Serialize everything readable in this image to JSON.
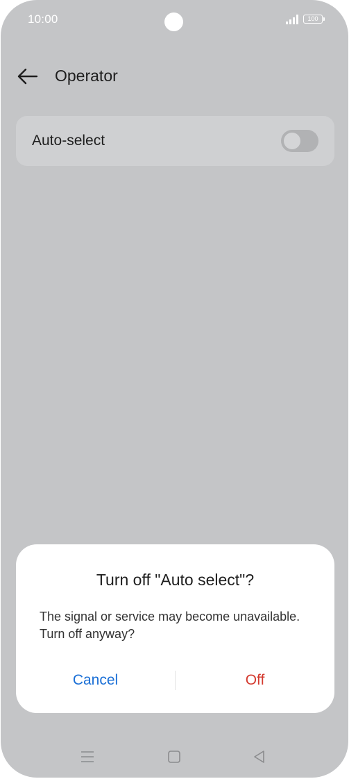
{
  "status_bar": {
    "time": "10:00",
    "battery": "100",
    "icons": [
      "signal-icon",
      "battery-icon"
    ]
  },
  "header": {
    "title": "Operator",
    "back_icon": "arrow-left-icon"
  },
  "setting": {
    "label": "Auto-select",
    "toggle_on": false
  },
  "dialog": {
    "title": "Turn off \"Auto select\"?",
    "message": "The signal or service may become unavailable. Turn off anyway?",
    "cancel_label": "Cancel",
    "off_label": "Off"
  },
  "nav_bar": {
    "icons": [
      "menu-icon",
      "home-icon",
      "back-triangle-icon"
    ]
  },
  "colors": {
    "background": "#c4c5c7",
    "cancel": "#1a6fd6",
    "off": "#d43a2f"
  }
}
